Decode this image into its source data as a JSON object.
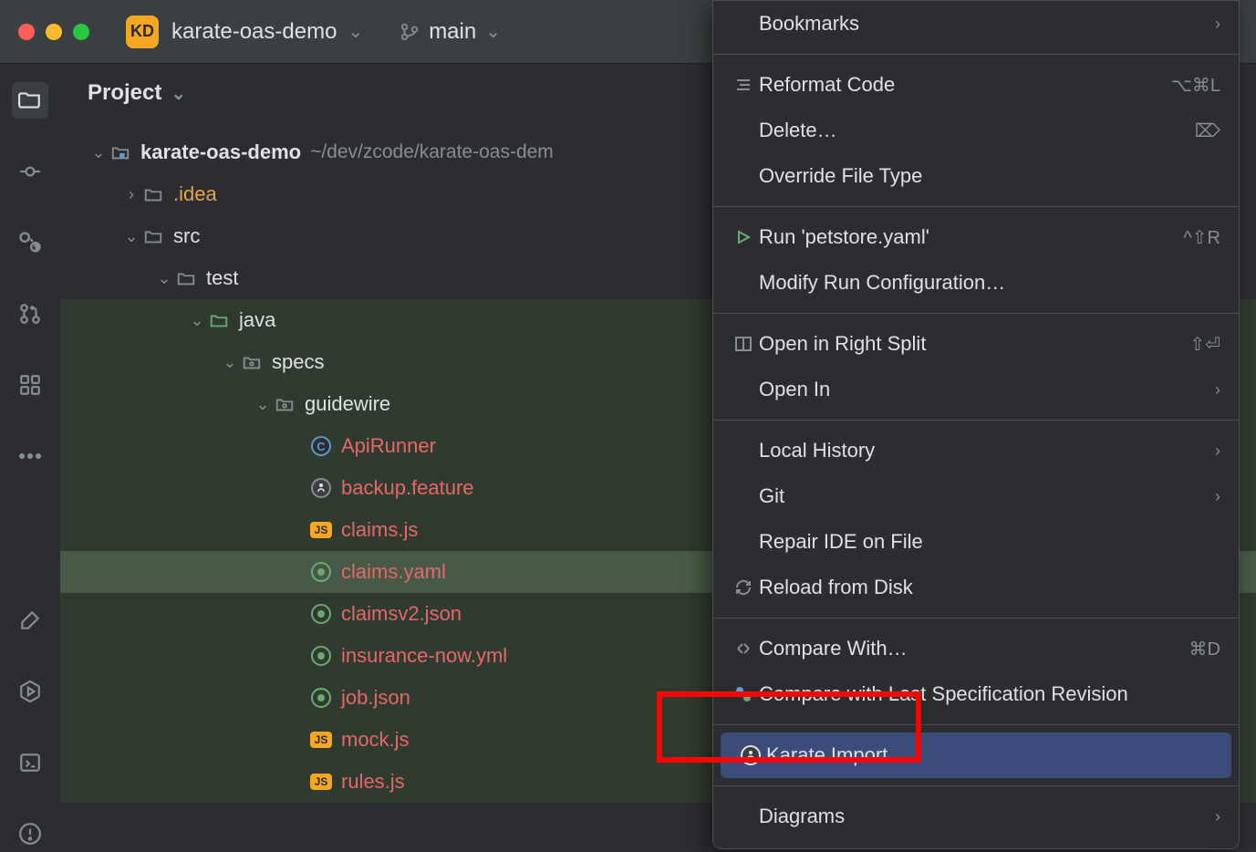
{
  "header": {
    "app_badge": "KD",
    "project_name": "karate-oas-demo",
    "branch": "main"
  },
  "panel": {
    "title": "Project"
  },
  "tree": {
    "root": {
      "name": "karate-oas-demo",
      "path": "~/dev/zcode/karate-oas-dem"
    },
    "idea": ".idea",
    "src": "src",
    "test": "test",
    "java": "java",
    "specs": "specs",
    "guidewire": "guidewire",
    "files": {
      "api_runner": "ApiRunner",
      "backup": "backup.feature",
      "claims_js": "claims.js",
      "claims_yaml": "claims.yaml",
      "claimsv2_json": "claimsv2.json",
      "insurance_now": "insurance-now.yml",
      "job_json": "job.json",
      "mock_js": "mock.js",
      "rules_js": "rules.js"
    }
  },
  "menu": {
    "bookmarks": "Bookmarks",
    "reformat": "Reformat Code",
    "reformat_shortcut": "⌥⌘L",
    "delete": "Delete…",
    "delete_shortcut": "⌦",
    "override": "Override File Type",
    "run": "Run 'petstore.yaml'",
    "run_shortcut": "^⇧R",
    "modify_run": "Modify Run Configuration…",
    "open_split": "Open in Right Split",
    "open_split_shortcut": "⇧⏎",
    "open_in": "Open In",
    "local_history": "Local History",
    "git": "Git",
    "repair": "Repair IDE on File",
    "reload": "Reload from Disk",
    "compare_with": "Compare With…",
    "compare_with_shortcut": "⌘D",
    "compare_last": "Compare with Last Specification Revision",
    "karate_import": "Karate Import",
    "diagrams": "Diagrams"
  }
}
